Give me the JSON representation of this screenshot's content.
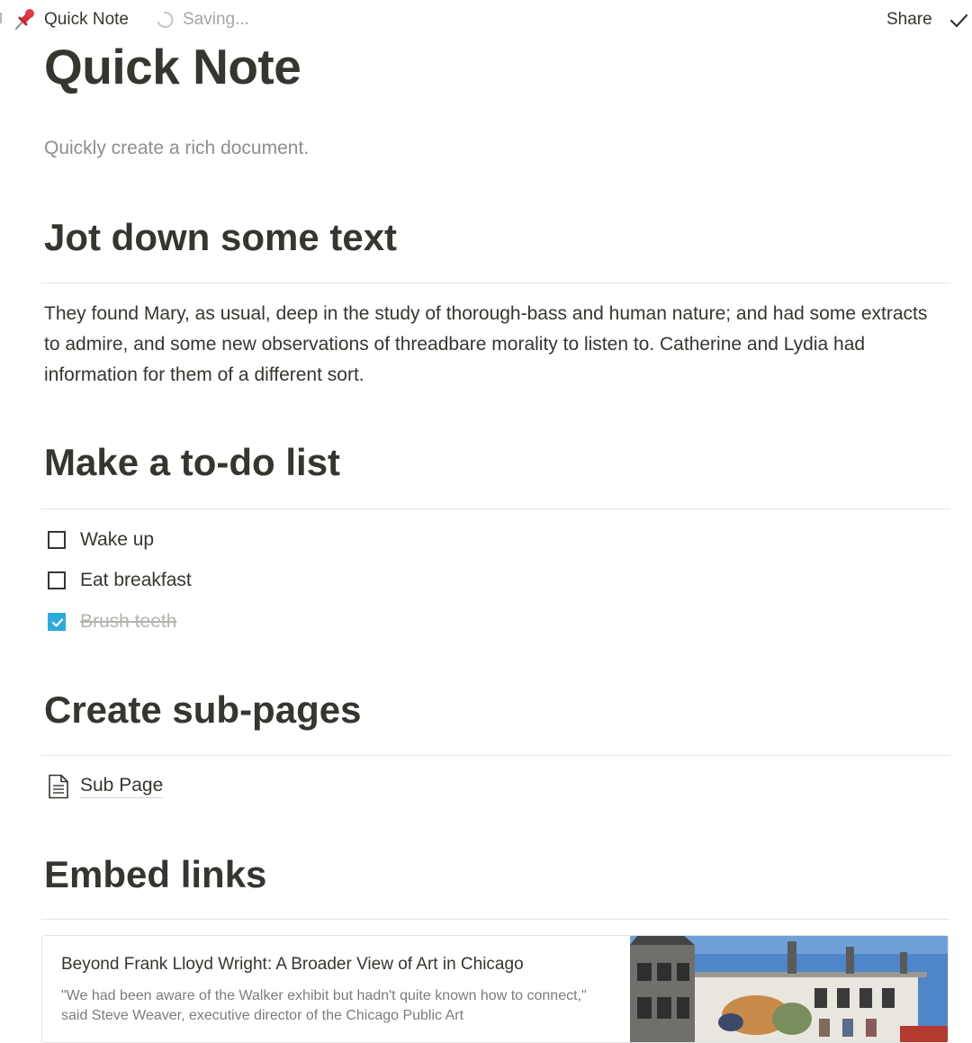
{
  "topbar": {
    "breadcrumb_title": "Quick Note",
    "status": "Saving...",
    "share_label": "Share",
    "icons": {
      "page": "pushpin-icon",
      "status": "spinner-icon",
      "action": "check-icon"
    }
  },
  "page": {
    "title": "Quick Note",
    "subtitle": "Quickly create a rich document."
  },
  "sections": {
    "text": {
      "heading": "Jot down some text",
      "paragraph": "They found Mary, as usual, deep in the study of thorough-bass and human nature; and had some extracts to admire, and some new observations of threadbare morality to listen to. Catherine and Lydia had information for them of a different sort."
    },
    "todo": {
      "heading": "Make a to-do list",
      "items": [
        {
          "label": "Wake up",
          "checked": false
        },
        {
          "label": "Eat breakfast",
          "checked": false
        },
        {
          "label": "Brush teeth",
          "checked": true
        }
      ]
    },
    "subpages": {
      "heading": "Create sub-pages",
      "items": [
        {
          "label": "Sub Page",
          "icon": "document-icon"
        }
      ]
    },
    "embed": {
      "heading": "Embed links",
      "bookmark": {
        "title": "Beyond Frank Lloyd Wright: A Broader View of Art in Chicago",
        "description": "\"We had been aware of the Walker exhibit but hadn't quite known how to connect,\" said Steve Weaver, executive director of the Chicago Public Art"
      }
    }
  },
  "colors": {
    "text": "#37352f",
    "muted": "#8f8e8a",
    "checkbox_accent": "#2eaadc",
    "divider": "#e6e6e4"
  }
}
